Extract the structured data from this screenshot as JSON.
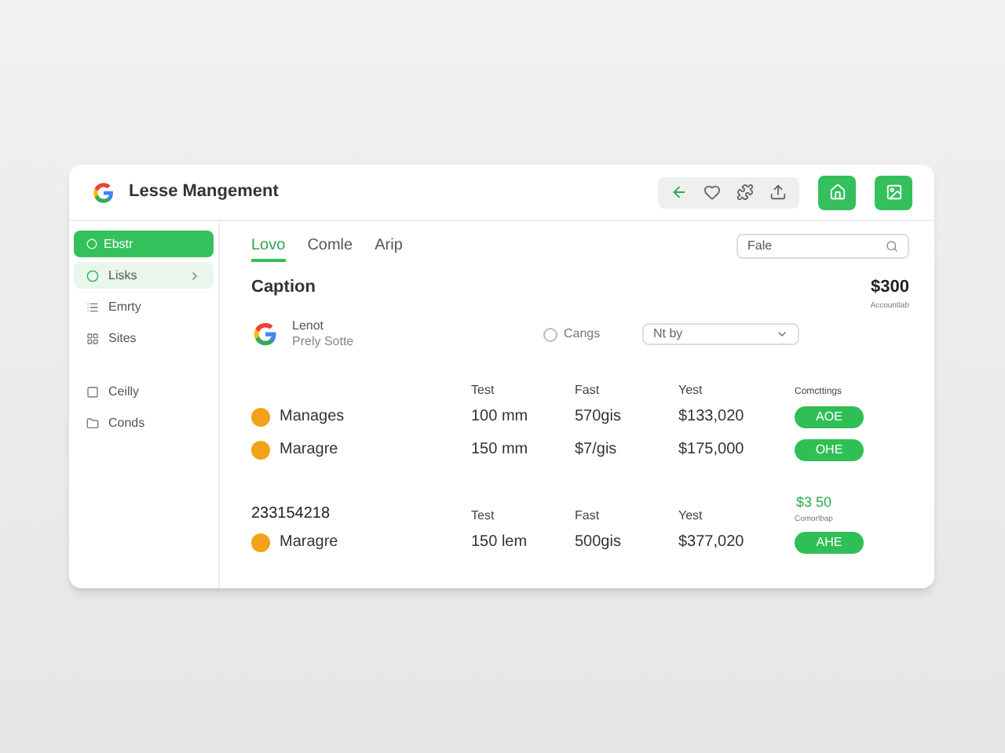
{
  "app": {
    "title": "Lesse Mangement"
  },
  "sidebar": {
    "primary_button": "Ebstr",
    "items": [
      {
        "label": "Lisks",
        "selected": true
      },
      {
        "label": "Emrty",
        "selected": false
      },
      {
        "label": "Sites",
        "selected": false
      },
      {
        "label": "Ceilly",
        "selected": false
      },
      {
        "label": "Conds",
        "selected": false
      }
    ]
  },
  "tabs": [
    {
      "label": "Lovo",
      "selected": true
    },
    {
      "label": "Comle",
      "selected": false
    },
    {
      "label": "Arip",
      "selected": false
    }
  ],
  "search": {
    "value": "Fale"
  },
  "caption": {
    "title": "Caption",
    "amount": "$300",
    "amount_note": "Accountlab"
  },
  "lead_row": {
    "name": "Lenot",
    "subtitle": "Prely Sotte",
    "radio_label": "Cangs",
    "radio_checked": false,
    "select_value": "Nt by"
  },
  "sections": [
    {
      "columns": [
        "Test",
        "Fast",
        "Yest",
        "Comcttings"
      ],
      "rows": [
        {
          "name": "Manages",
          "size": "100 mm",
          "weight": "570gis",
          "price": "$133,020",
          "action": "AOE"
        },
        {
          "name": "Maragre",
          "size": "150 mm",
          "weight": "$7/gis",
          "price": "$175,000",
          "action": "OHE"
        }
      ]
    },
    {
      "title": "233154218",
      "total": "$3 50",
      "total_note": "Comorlbap",
      "columns": [
        "Test",
        "Fast",
        "Yest"
      ],
      "rows": [
        {
          "name": "Maragre",
          "size": "150 lem",
          "weight": "500gis",
          "price": "$377,020",
          "action": "AHE"
        }
      ]
    }
  ]
}
